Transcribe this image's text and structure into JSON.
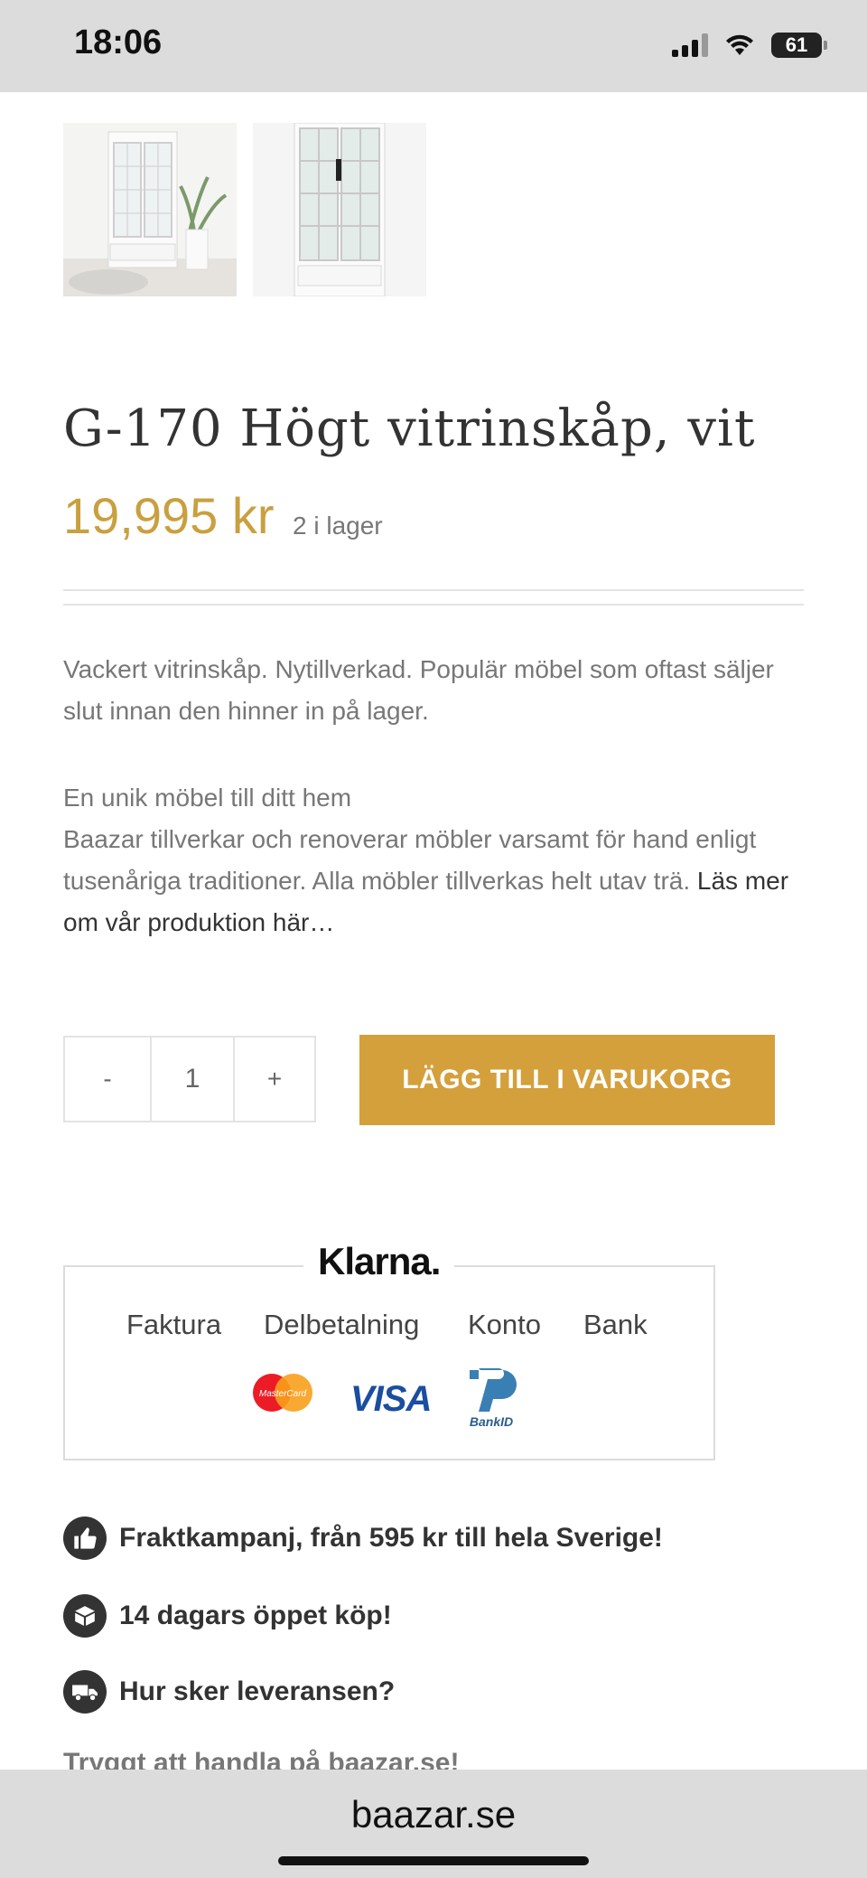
{
  "status_bar": {
    "time": "18:06",
    "battery": "61"
  },
  "product": {
    "title": "G-170 Högt vitrinskåp, vit",
    "price": "19,995 kr",
    "stock": "2 i lager"
  },
  "description": {
    "p1": "Vackert vitrinskåp. Nytillverkad. Populär möbel som oftast säljer slut innan den hinner in på lager.",
    "heading": "En unik möbel till ditt hem",
    "body": "Baazar tillverkar och renoverar möbler varsamt för hand enligt tusenåriga traditioner. Alla möbler tillverkas helt utav trä.",
    "link": "Läs mer om vår produktion här…"
  },
  "quantity": {
    "minus": "-",
    "value": "1",
    "plus": "+"
  },
  "cart": {
    "button_label": "LÄGG TILL I VARUKORG"
  },
  "klarna": {
    "logo": "Klarna.",
    "methods": [
      "Faktura",
      "Delbetalning",
      "Konto",
      "Bank"
    ],
    "card_icons": [
      "mastercard-icon",
      "visa-icon",
      "bankid-icon"
    ],
    "visa_label": "VISA",
    "mastercard_label": "MasterCard",
    "bankid_label": "BankID"
  },
  "features": [
    {
      "icon": "thumbs-up-icon",
      "text": "Fraktkampanj, från 595 kr till hela Sverige!"
    },
    {
      "icon": "box-icon",
      "text": "14 dagars öppet köp!"
    },
    {
      "icon": "truck-icon",
      "text": "Hur sker leveransen?"
    }
  ],
  "partial_text": "Tryggt att handla på baazar.se!",
  "browser": {
    "url": "baazar.se"
  },
  "colors": {
    "accent": "#d4a03c",
    "price": "#c9a03f",
    "text": "#333333"
  }
}
